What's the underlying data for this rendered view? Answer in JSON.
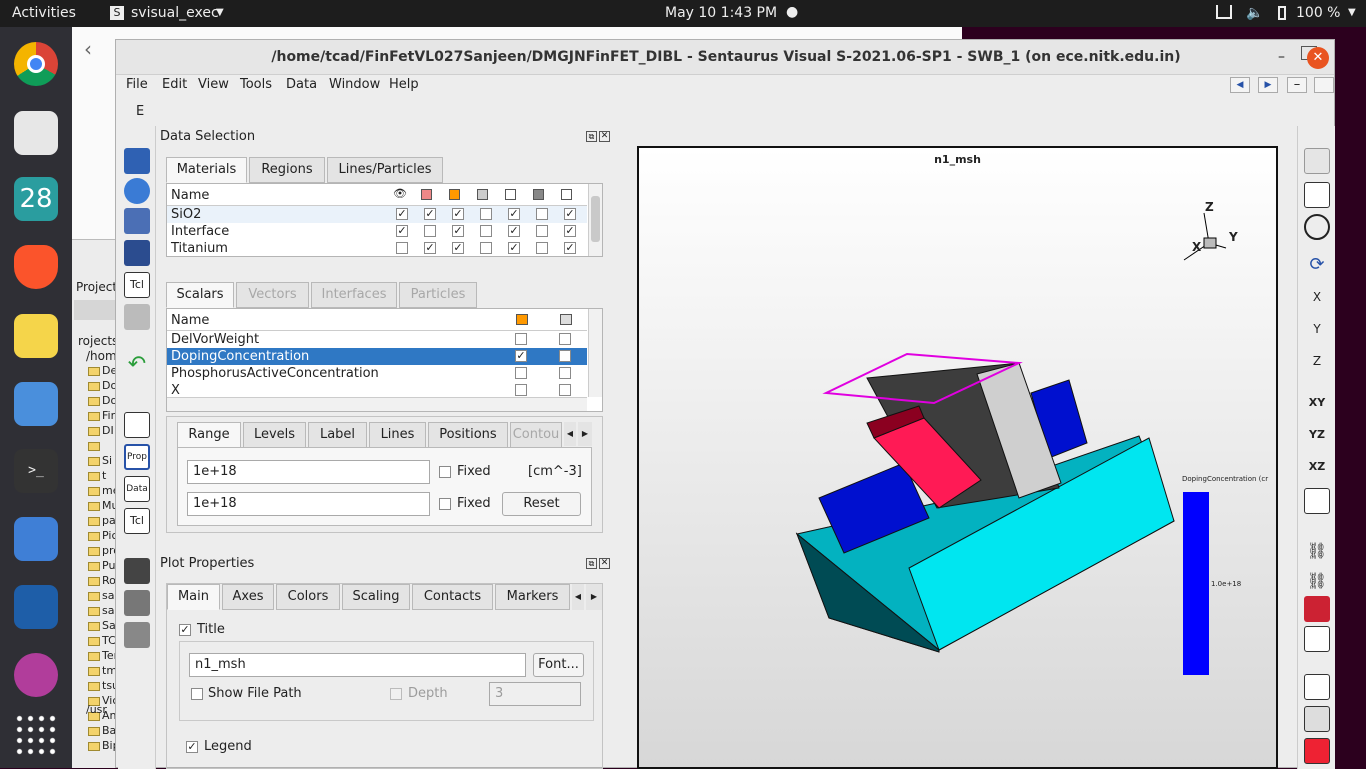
{
  "topbar": {
    "activities": "Activities",
    "app": "svisual_exec",
    "datetime": "May 10  1:43 PM",
    "battery": "100 %"
  },
  "dock": {
    "calendar_day": "28"
  },
  "bgwin": {
    "project_menu": "Project",
    "tree_root": "rojects",
    "tree_home": "/hom",
    "tree_usr": "/usr",
    "tree_items": [
      "Des",
      "Doc",
      "Dov",
      "Fir",
      "DI",
      "",
      "Si",
      "t",
      "mei",
      "Mus",
      "pai",
      "Pic",
      "pro",
      "Pub",
      "Roh",
      "san",
      "san",
      "Sar",
      "TCA",
      "Ten",
      "tmp",
      "tsu",
      "Vic",
      "Ana",
      "Bac",
      "Bip"
    ]
  },
  "window": {
    "title": "/home/tcad/FinFetVL027Sanjeen/DMGJNFinFET_DIBL - Sentaurus Visual S-2021.06-SP1 - SWB_1 (on ece.nitk.edu.in)"
  },
  "menus": [
    "File",
    "Edit",
    "View",
    "Tools",
    "Data",
    "Window",
    "Help"
  ],
  "toolbar": {
    "e_label": "E"
  },
  "data_selection": {
    "title": "Data Selection",
    "tabs": [
      "Materials",
      "Regions",
      "Lines/Particles"
    ],
    "name_header": "Name",
    "materials": [
      {
        "name": "SiO2",
        "checks": [
          true,
          true,
          true,
          false,
          true,
          false,
          true
        ]
      },
      {
        "name": "Interface",
        "checks": [
          true,
          false,
          true,
          false,
          true,
          false,
          true
        ]
      },
      {
        "name": "Titanium",
        "checks": [
          false,
          true,
          true,
          false,
          true,
          false,
          true
        ]
      }
    ],
    "scalar_tabs": [
      "Scalars",
      "Vectors",
      "Interfaces",
      "Particles"
    ],
    "scalars": [
      {
        "name": "DelVorWeight",
        "checks": [
          false,
          false
        ]
      },
      {
        "name": "DopingConcentration",
        "checks": [
          true,
          false
        ]
      },
      {
        "name": "PhosphorusActiveConcentration",
        "checks": [
          false,
          false
        ]
      },
      {
        "name": "X",
        "checks": [
          false,
          false
        ]
      }
    ],
    "range_tabs": [
      "Range",
      "Levels",
      "Label",
      "Lines",
      "Positions",
      "Contou"
    ],
    "range_max": "1e+18",
    "range_min": "1e+18",
    "fixed_label": "Fixed",
    "unit": "[cm^-3]",
    "reset_label": "Reset"
  },
  "plot_properties": {
    "title": "Plot Properties",
    "tabs": [
      "Main",
      "Axes",
      "Colors",
      "Scaling",
      "Contacts",
      "Markers"
    ],
    "title_check_label": "Title",
    "title_value": "n1_msh",
    "font_button": "Font...",
    "show_file_path_label": "Show File Path",
    "depth_label": "Depth",
    "depth_value": "3",
    "legend_label": "Legend"
  },
  "left_tools": {
    "tcl": "Tcl",
    "prop": "Prop",
    "data": "Data",
    "tcl2": "Tcl"
  },
  "plot": {
    "title": "n1_msh",
    "axis_z": "Z",
    "axis_y": "Y",
    "axis_x": "X",
    "legend_title": "DopingConcentration (cr",
    "legend_value": "1.0e+18"
  }
}
